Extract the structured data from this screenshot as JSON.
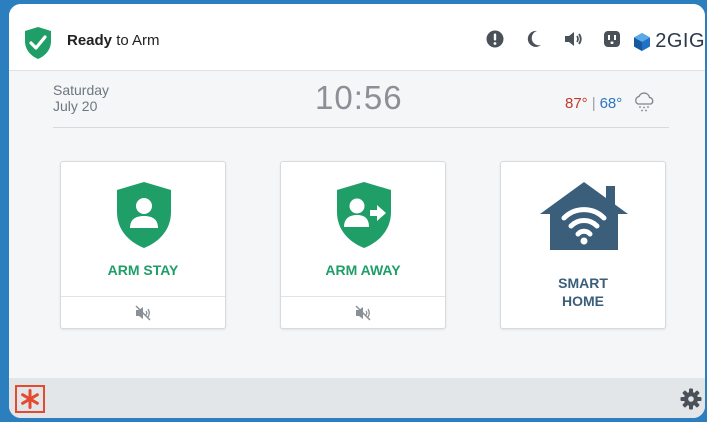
{
  "status": {
    "bold": "Ready",
    "rest": " to Arm",
    "icon": "check-shield-icon",
    "color": "#1f9e68"
  },
  "top_icons": [
    "alert-icon",
    "moon-icon",
    "volume-icon",
    "outlet-icon"
  ],
  "brand": {
    "text": "2GIG",
    "icon": "2gig-cube-icon"
  },
  "date": {
    "day": "Saturday",
    "date": "July 20"
  },
  "time": "10:56",
  "weather": {
    "high": "87°",
    "separator": "|",
    "low": "68°",
    "icon": "snow-cloud-icon"
  },
  "tiles": [
    {
      "label": "ARM STAY",
      "icon": "shield-person-icon",
      "sub_icon": "muted-speaker-icon"
    },
    {
      "label": "ARM AWAY",
      "icon": "shield-person-arrow-icon",
      "sub_icon": "muted-speaker-icon"
    },
    {
      "label_line1": "SMART",
      "label_line2": "HOME",
      "icon": "wifi-house-icon"
    }
  ],
  "bottom": {
    "left_icon": "asterisk-icon",
    "right_icon": "gear-icon"
  },
  "colors": {
    "accent_green": "#1f9e68",
    "brand_blue": "#3b5f7b",
    "high_temp": "#c0392b",
    "low_temp": "#2b76c1",
    "frame": "#2b7fbf"
  }
}
